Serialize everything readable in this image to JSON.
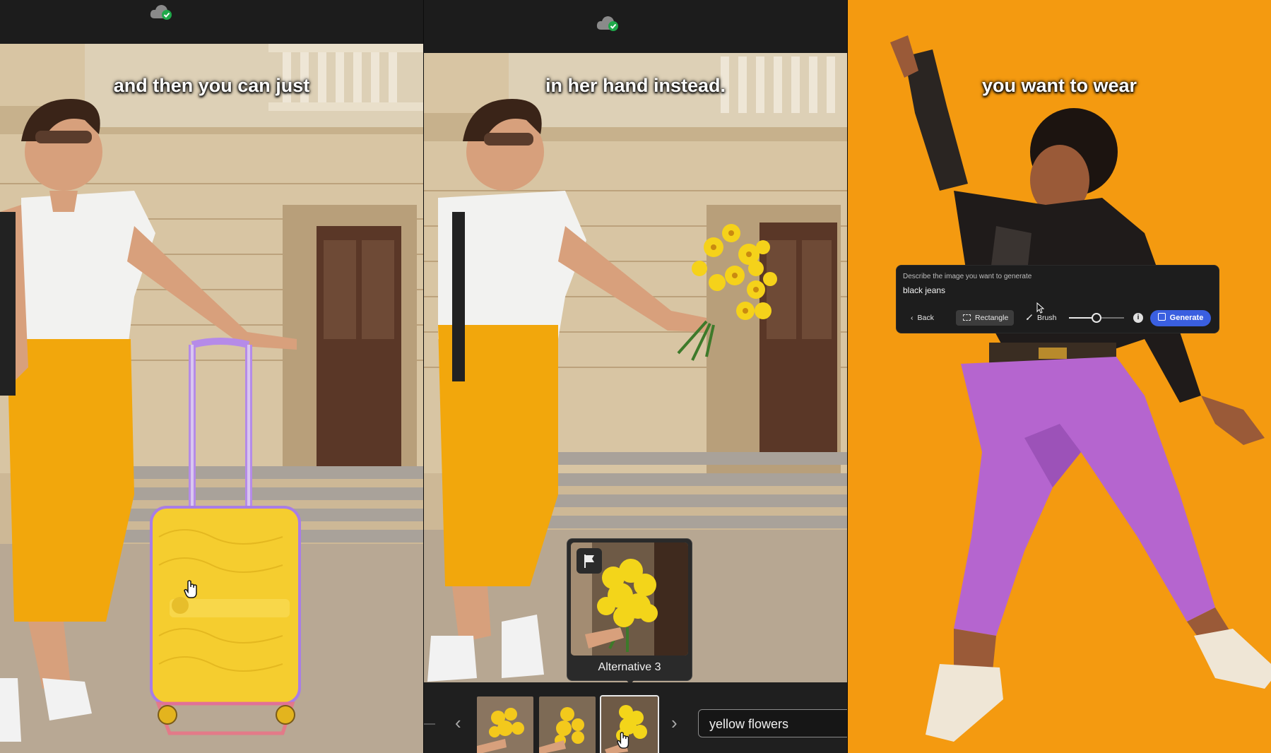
{
  "panels": [
    {
      "caption": "and then you can just",
      "status_icon": "cloud-synced-icon"
    },
    {
      "caption": "in her hand instead.",
      "status_icon": "cloud-synced-icon",
      "variations": {
        "popover_label": "Alternative 3",
        "prompt_value": "yellow flowers",
        "prev_glyph": "‹",
        "next_glyph": "›",
        "selected_index": 3
      }
    },
    {
      "caption": "you want to wear",
      "generate_dialog": {
        "hint": "Describe the image you want to generate",
        "prompt": "black jeans",
        "back_label": "Back",
        "rectangle_label": "Rectangle",
        "brush_label": "Brush",
        "brush_size": 0.5,
        "generate_label": "Generate"
      }
    }
  ],
  "colors": {
    "accent": "#3a5fe0",
    "orange_background": "#f49a10",
    "toolbar": "#1c1c1c",
    "synced_green": "#1fa84a"
  }
}
